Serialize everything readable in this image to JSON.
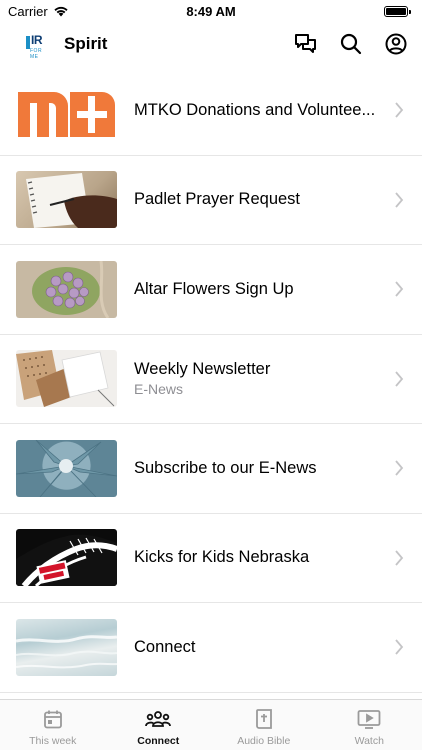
{
  "status": {
    "carrier": "Carrier",
    "time": "8:49 AM"
  },
  "header": {
    "logo_text": "IR",
    "logo_sub": "FOR ME",
    "title": "Spirit",
    "icons": [
      "chat-bubbles-icon",
      "search-icon",
      "profile-icon"
    ]
  },
  "items": [
    {
      "title": "MTKO Donations and Voluntee...",
      "subtitle": "",
      "thumb": "mtko-logo-image"
    },
    {
      "title": "Padlet Prayer Request",
      "subtitle": "",
      "thumb": "notebook-writing-image"
    },
    {
      "title": "Altar Flowers Sign Up",
      "subtitle": "",
      "thumb": "flowers-image"
    },
    {
      "title": "Weekly Newsletter",
      "subtitle": "E-News",
      "thumb": "paper-cards-image"
    },
    {
      "title": "Subscribe to our E-News",
      "subtitle": "",
      "thumb": "succulent-plant-image"
    },
    {
      "title": "Kicks for Kids Nebraska",
      "subtitle": "",
      "thumb": "kicks-for-kids-image"
    },
    {
      "title": "Connect",
      "subtitle": "",
      "thumb": "water-waves-image"
    }
  ],
  "tabs": [
    {
      "label": "This week",
      "icon": "calendar-icon",
      "active": false
    },
    {
      "label": "Connect",
      "icon": "people-group-icon",
      "active": true
    },
    {
      "label": "Audio Bible",
      "icon": "bible-icon",
      "active": false
    },
    {
      "label": "Watch",
      "icon": "play-video-icon",
      "active": false
    }
  ],
  "colors": {
    "mtko_orange": "#f0793a",
    "separator": "#e6e6e6",
    "inactive_tab": "#9a9a9a",
    "active_tab": "#111111"
  }
}
